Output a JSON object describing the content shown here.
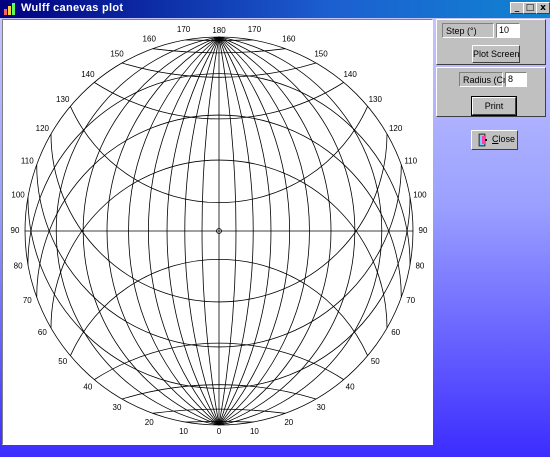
{
  "window": {
    "title": "Wulff  canevas  plot",
    "controls": {
      "minimize": "_",
      "maximize": "□",
      "close": "x"
    }
  },
  "panel_step": {
    "step_label": "Step (°)",
    "step_value": "10",
    "plot_button": "Plot Screen"
  },
  "panel_print": {
    "radius_label": "Radius (Cm)",
    "radius_value": "8",
    "print_button": "Print"
  },
  "close_button": {
    "label_underlined": "C",
    "label_rest": "lose"
  },
  "plot": {
    "type": "wulff-net",
    "step_degrees": 10,
    "great_circles_count": 17,
    "small_circles_count": 17,
    "top_label": "180",
    "bottom_label": "0",
    "left_labels": [
      "170",
      "160",
      "150",
      "140",
      "130",
      "120",
      "110",
      "100",
      "90",
      "80",
      "70",
      "60",
      "50",
      "40",
      "30",
      "20",
      "10"
    ],
    "right_labels": [
      "170",
      "160",
      "150",
      "140",
      "130",
      "120",
      "110",
      "100",
      "90",
      "80",
      "70",
      "60",
      "50",
      "40",
      "30",
      "20",
      "10"
    ]
  }
}
